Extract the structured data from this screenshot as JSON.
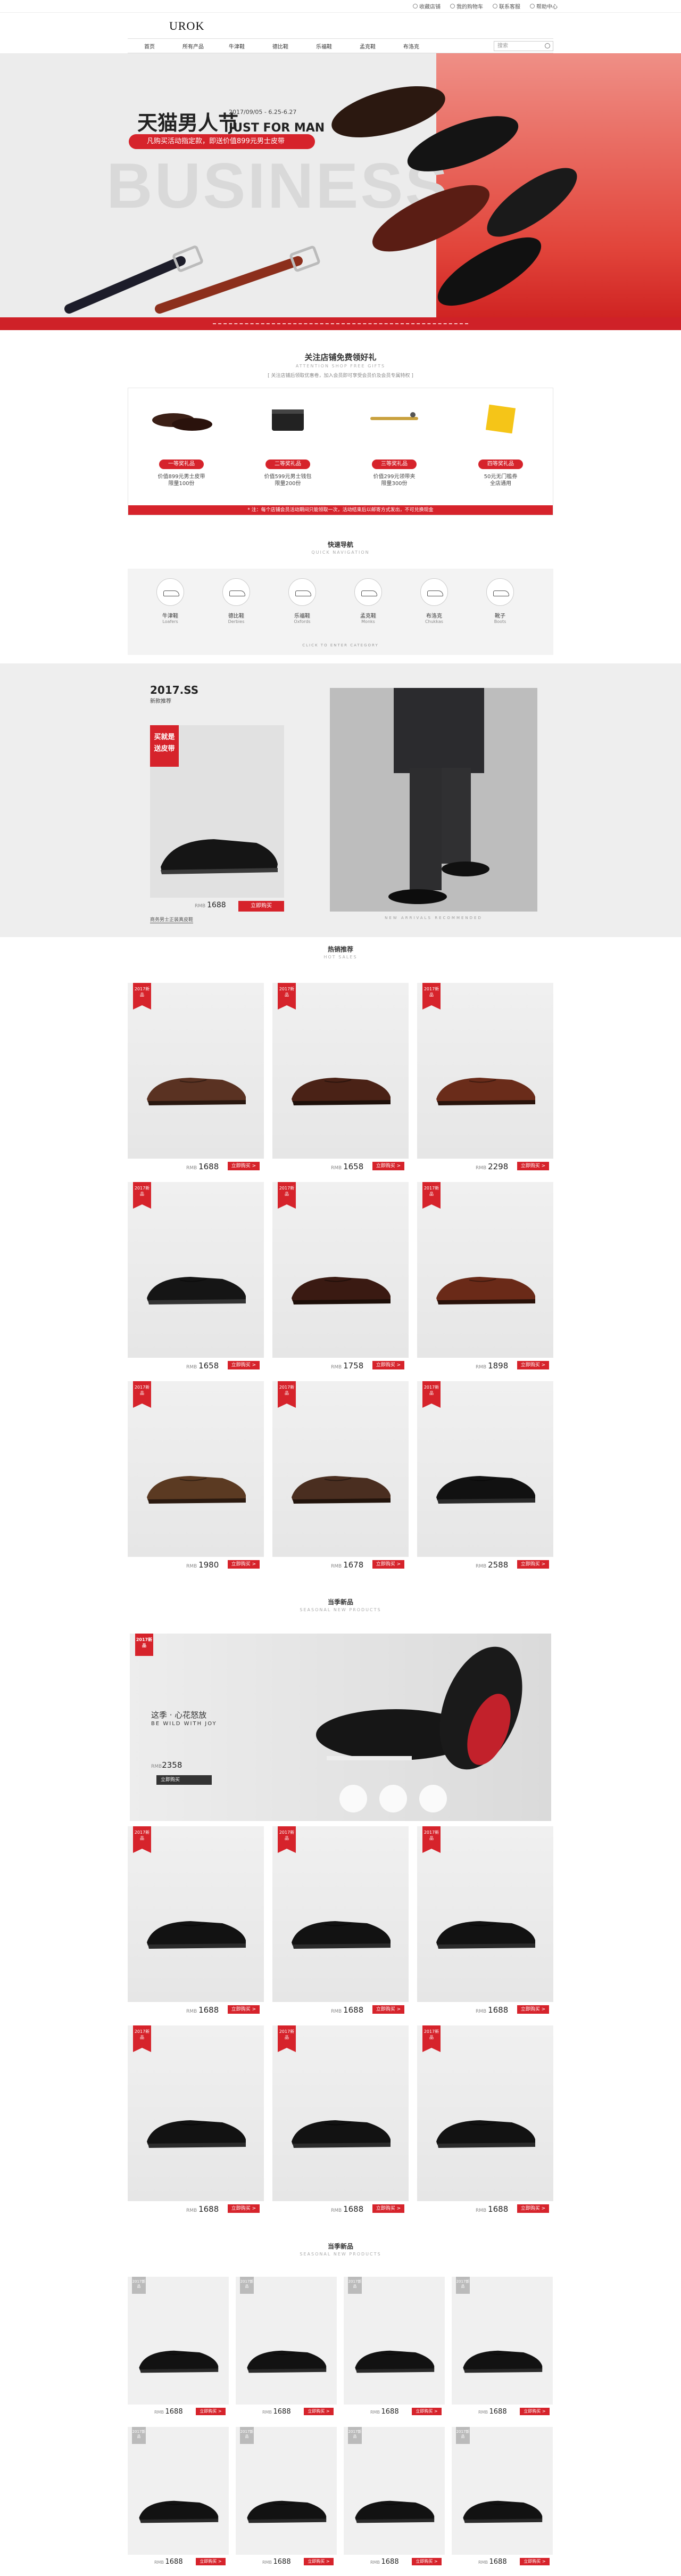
{
  "util_links": [
    "收藏店铺",
    "我的购物车",
    "联系客服",
    "帮助中心"
  ],
  "brand": {
    "logo": "UROK"
  },
  "nav": {
    "items": [
      "首页",
      "所有产品",
      "牛津鞋",
      "德比鞋",
      "乐福鞋",
      "孟克鞋",
      "布洛克"
    ],
    "search_placeholder": "搜索"
  },
  "hero": {
    "title_cn": "天猫男人节",
    "title_en": "JUST FOR MAN",
    "date": "2017/09/05 - 6.25-6.27",
    "pill": "凡购买活动指定款，即送价值899元男士皮带",
    "bg_text": "BUSINESS"
  },
  "coupon_section": {
    "title": "关注店铺免费领好礼",
    "subtitle": "ATTENTION SHOP FREE GIFTS",
    "note": "[ 关注店铺后领取优惠卷，加入会员即可享受会员价及会员专属特权 ]",
    "items": [
      {
        "btn": "一等奖礼品",
        "line1": "价值899元男士皮带",
        "line2": "限量100份"
      },
      {
        "btn": "二等奖礼品",
        "line1": "价值599元男士钱包",
        "line2": "限量200份"
      },
      {
        "btn": "三等奖礼品",
        "line1": "价值299元领带夹",
        "line2": "限量300份"
      },
      {
        "btn": "四等奖礼品",
        "line1": "50元无门槛券",
        "line2": "全店通用"
      }
    ],
    "bar_text": "* 注：每个店铺会员活动期间只能领取一次，活动结束后以邮寄方式发出，不可兑换现金"
  },
  "category_section": {
    "title": "快速导航",
    "subtitle": "QUICK NAVIGATION",
    "items": [
      {
        "cn": "牛津鞋",
        "en": "Loafers"
      },
      {
        "cn": "德比鞋",
        "en": "Derbies"
      },
      {
        "cn": "乐福鞋",
        "en": "Oxfords"
      },
      {
        "cn": "孟克鞋",
        "en": "Monks"
      },
      {
        "cn": "布洛克",
        "en": "Chukkas"
      },
      {
        "cn": "靴子",
        "en": "Boots"
      }
    ],
    "footer": "CLICK TO ENTER CATEGORY"
  },
  "featured": {
    "season": "2017.SS",
    "label": "新款推荐",
    "red_lines": [
      "买就是",
      "送皮带"
    ],
    "price_label": "RMB",
    "price": "1688",
    "buy": "立即购买",
    "caption": "商务男士正装真皮鞋",
    "footer_text": "NEW ARRIVALS RECOMMENDED"
  },
  "hot_section": {
    "title": "热销推荐",
    "subtitle": "HOT SALES",
    "tag": "2017新品",
    "buy": "立即购买 >",
    "price_label": "RMB",
    "prices": [
      "1688",
      "1658",
      "2298",
      "1658",
      "1758",
      "1898",
      "1980",
      "1678",
      "2588"
    ]
  },
  "spring_section": {
    "title": "当季新品",
    "subtitle": "SEASONAL NEW PRODUCTS",
    "banner_cn": "这季 · 心花怒放",
    "banner_en": "BE WILD WITH JOY",
    "banner_price_label": "RMB",
    "banner_price": "2358",
    "banner_buy": "立即购买",
    "prices": [
      "1688",
      "1688",
      "1688",
      "1688",
      "1688",
      "1688"
    ]
  },
  "season2_section": {
    "title": "当季新品",
    "subtitle": "SEASONAL NEW PRODUCTS",
    "prices": [
      "1688",
      "1688",
      "1688",
      "1688",
      "1688",
      "1688",
      "1688",
      "1688"
    ]
  },
  "colors": {
    "accent": "#d6232b",
    "hero_red": "#e2453b"
  }
}
